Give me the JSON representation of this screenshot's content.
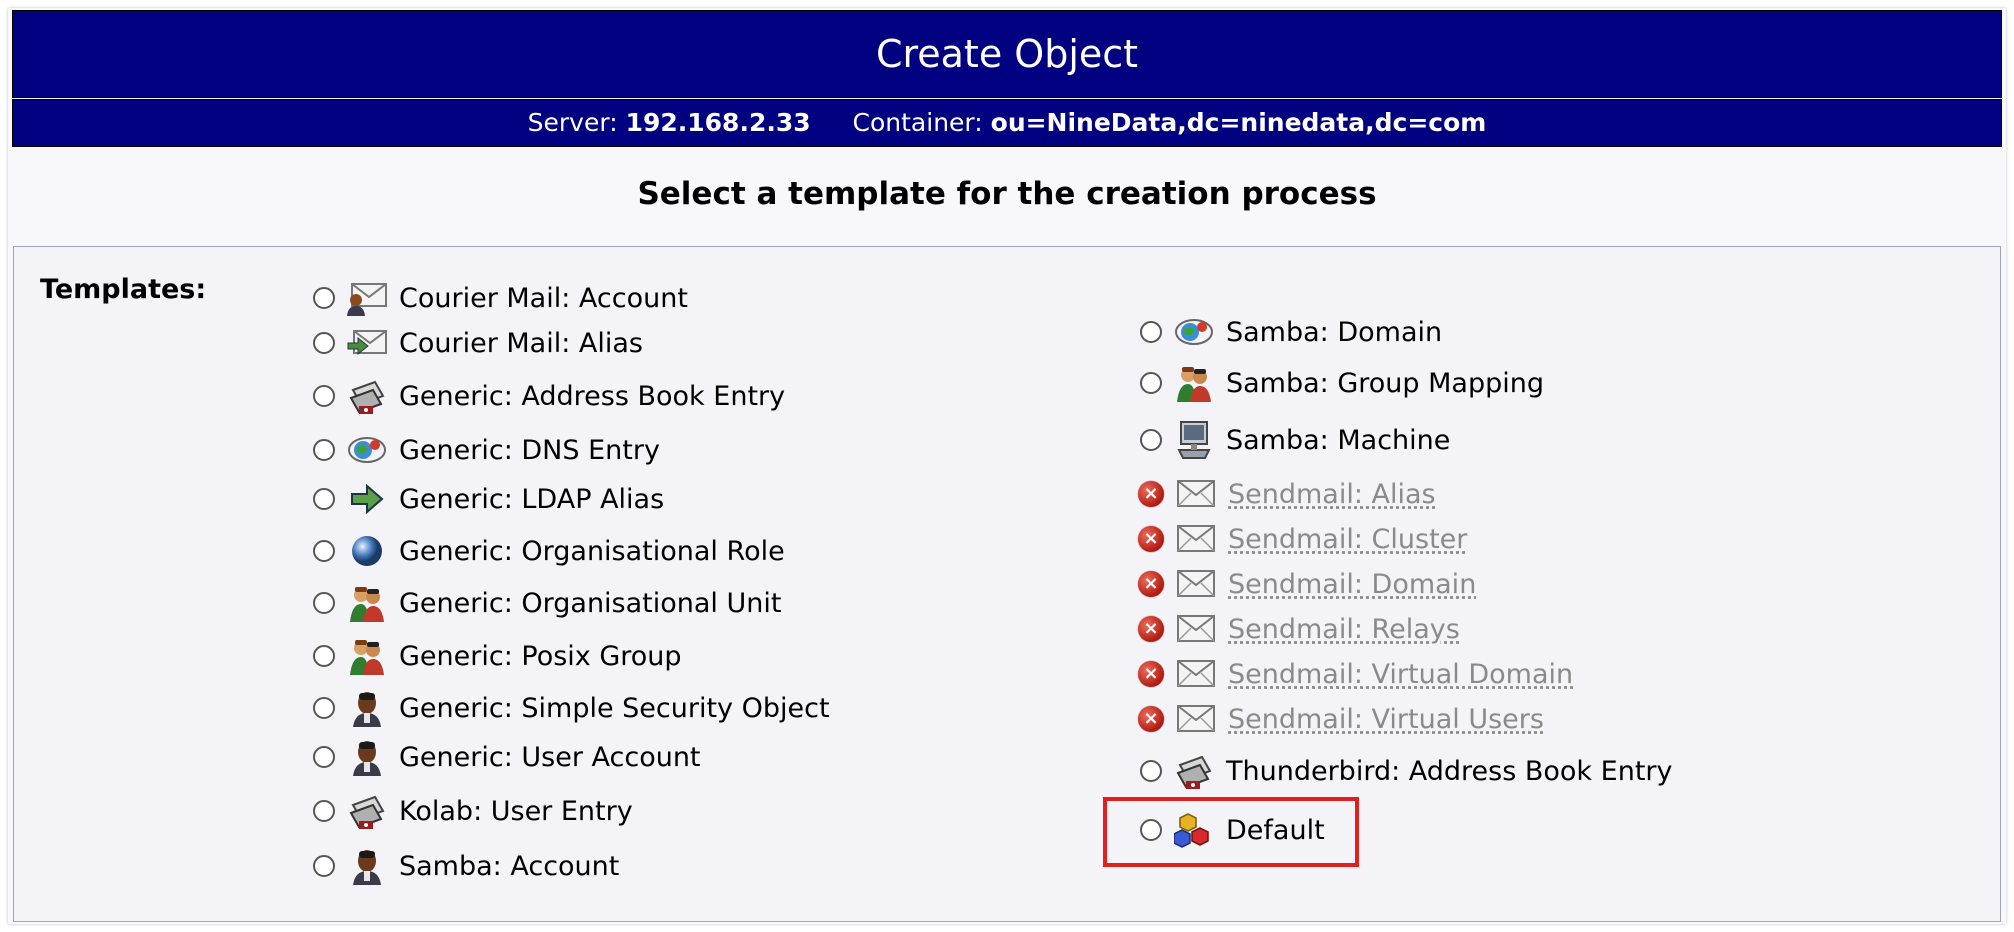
{
  "header": {
    "title": "Create Object",
    "server_label": "Server:",
    "server_value": "192.168.2.33",
    "container_label": "Container:",
    "container_value": "ou=NineData,dc=ninedata,dc=com"
  },
  "heading": "Select a template for the creation process",
  "templates_label": "Templates:",
  "left_templates": [
    {
      "label": "Courier Mail: Account",
      "icon": "user-mail-icon",
      "enabled": true
    },
    {
      "label": "Courier Mail: Alias",
      "icon": "mail-alias-icon",
      "enabled": true
    },
    {
      "label": "Generic: Address Book Entry",
      "icon": "address-book-icon",
      "enabled": true
    },
    {
      "label": "Generic: DNS Entry",
      "icon": "dns-icon",
      "enabled": true
    },
    {
      "label": "Generic: LDAP Alias",
      "icon": "arrow-right-icon",
      "enabled": true
    },
    {
      "label": "Generic: Organisational Role",
      "icon": "globe-icon",
      "enabled": true
    },
    {
      "label": "Generic: Organisational Unit",
      "icon": "group-icon",
      "enabled": true
    },
    {
      "label": "Generic: Posix Group",
      "icon": "group-icon",
      "enabled": true
    },
    {
      "label": "Generic: Simple Security Object",
      "icon": "user-icon",
      "enabled": true
    },
    {
      "label": "Generic: User Account",
      "icon": "user-icon",
      "enabled": true
    },
    {
      "label": "Kolab: User Entry",
      "icon": "address-book-icon",
      "enabled": true
    },
    {
      "label": "Samba: Account",
      "icon": "user-icon",
      "enabled": true
    }
  ],
  "right_templates": [
    {
      "label": "Samba: Domain",
      "icon": "dns-icon",
      "enabled": true
    },
    {
      "label": "Samba: Group Mapping",
      "icon": "group-icon",
      "enabled": true
    },
    {
      "label": "Samba: Machine",
      "icon": "computer-icon",
      "enabled": true
    },
    {
      "label": "Sendmail: Alias",
      "icon": "mail-icon",
      "enabled": false
    },
    {
      "label": "Sendmail: Cluster",
      "icon": "mail-icon",
      "enabled": false
    },
    {
      "label": "Sendmail: Domain",
      "icon": "mail-icon",
      "enabled": false
    },
    {
      "label": "Sendmail: Relays",
      "icon": "mail-icon",
      "enabled": false
    },
    {
      "label": "Sendmail: Virtual Domain",
      "icon": "mail-icon",
      "enabled": false
    },
    {
      "label": "Sendmail: Virtual Users",
      "icon": "mail-icon",
      "enabled": false
    },
    {
      "label": "Thunderbird: Address Book Entry",
      "icon": "address-book-icon",
      "enabled": true
    },
    {
      "label": "Default",
      "icon": "cubes-icon",
      "enabled": true
    }
  ],
  "colors": {
    "header_bg": "#000080",
    "highlight_border": "#e0201c",
    "disabled_text": "#8a8a8a"
  }
}
